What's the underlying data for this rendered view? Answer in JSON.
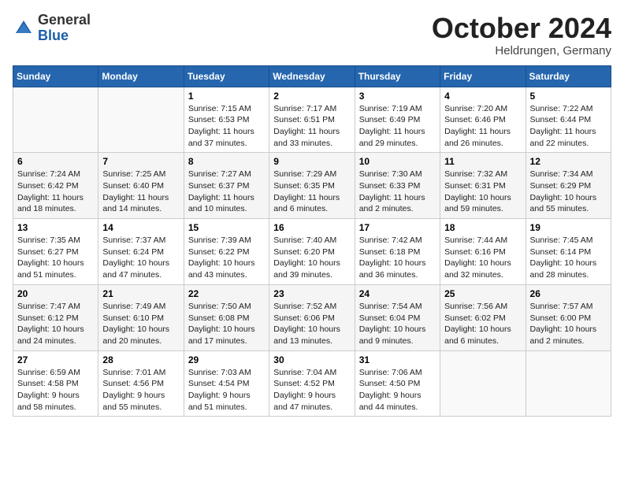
{
  "header": {
    "logo_general": "General",
    "logo_blue": "Blue",
    "month": "October 2024",
    "location": "Heldrungen, Germany"
  },
  "days_of_week": [
    "Sunday",
    "Monday",
    "Tuesday",
    "Wednesday",
    "Thursday",
    "Friday",
    "Saturday"
  ],
  "weeks": [
    [
      {
        "day": "",
        "sunrise": "",
        "sunset": "",
        "daylight": ""
      },
      {
        "day": "",
        "sunrise": "",
        "sunset": "",
        "daylight": ""
      },
      {
        "day": "1",
        "sunrise": "Sunrise: 7:15 AM",
        "sunset": "Sunset: 6:53 PM",
        "daylight": "Daylight: 11 hours and 37 minutes."
      },
      {
        "day": "2",
        "sunrise": "Sunrise: 7:17 AM",
        "sunset": "Sunset: 6:51 PM",
        "daylight": "Daylight: 11 hours and 33 minutes."
      },
      {
        "day": "3",
        "sunrise": "Sunrise: 7:19 AM",
        "sunset": "Sunset: 6:49 PM",
        "daylight": "Daylight: 11 hours and 29 minutes."
      },
      {
        "day": "4",
        "sunrise": "Sunrise: 7:20 AM",
        "sunset": "Sunset: 6:46 PM",
        "daylight": "Daylight: 11 hours and 26 minutes."
      },
      {
        "day": "5",
        "sunrise": "Sunrise: 7:22 AM",
        "sunset": "Sunset: 6:44 PM",
        "daylight": "Daylight: 11 hours and 22 minutes."
      }
    ],
    [
      {
        "day": "6",
        "sunrise": "Sunrise: 7:24 AM",
        "sunset": "Sunset: 6:42 PM",
        "daylight": "Daylight: 11 hours and 18 minutes."
      },
      {
        "day": "7",
        "sunrise": "Sunrise: 7:25 AM",
        "sunset": "Sunset: 6:40 PM",
        "daylight": "Daylight: 11 hours and 14 minutes."
      },
      {
        "day": "8",
        "sunrise": "Sunrise: 7:27 AM",
        "sunset": "Sunset: 6:37 PM",
        "daylight": "Daylight: 11 hours and 10 minutes."
      },
      {
        "day": "9",
        "sunrise": "Sunrise: 7:29 AM",
        "sunset": "Sunset: 6:35 PM",
        "daylight": "Daylight: 11 hours and 6 minutes."
      },
      {
        "day": "10",
        "sunrise": "Sunrise: 7:30 AM",
        "sunset": "Sunset: 6:33 PM",
        "daylight": "Daylight: 11 hours and 2 minutes."
      },
      {
        "day": "11",
        "sunrise": "Sunrise: 7:32 AM",
        "sunset": "Sunset: 6:31 PM",
        "daylight": "Daylight: 10 hours and 59 minutes."
      },
      {
        "day": "12",
        "sunrise": "Sunrise: 7:34 AM",
        "sunset": "Sunset: 6:29 PM",
        "daylight": "Daylight: 10 hours and 55 minutes."
      }
    ],
    [
      {
        "day": "13",
        "sunrise": "Sunrise: 7:35 AM",
        "sunset": "Sunset: 6:27 PM",
        "daylight": "Daylight: 10 hours and 51 minutes."
      },
      {
        "day": "14",
        "sunrise": "Sunrise: 7:37 AM",
        "sunset": "Sunset: 6:24 PM",
        "daylight": "Daylight: 10 hours and 47 minutes."
      },
      {
        "day": "15",
        "sunrise": "Sunrise: 7:39 AM",
        "sunset": "Sunset: 6:22 PM",
        "daylight": "Daylight: 10 hours and 43 minutes."
      },
      {
        "day": "16",
        "sunrise": "Sunrise: 7:40 AM",
        "sunset": "Sunset: 6:20 PM",
        "daylight": "Daylight: 10 hours and 39 minutes."
      },
      {
        "day": "17",
        "sunrise": "Sunrise: 7:42 AM",
        "sunset": "Sunset: 6:18 PM",
        "daylight": "Daylight: 10 hours and 36 minutes."
      },
      {
        "day": "18",
        "sunrise": "Sunrise: 7:44 AM",
        "sunset": "Sunset: 6:16 PM",
        "daylight": "Daylight: 10 hours and 32 minutes."
      },
      {
        "day": "19",
        "sunrise": "Sunrise: 7:45 AM",
        "sunset": "Sunset: 6:14 PM",
        "daylight": "Daylight: 10 hours and 28 minutes."
      }
    ],
    [
      {
        "day": "20",
        "sunrise": "Sunrise: 7:47 AM",
        "sunset": "Sunset: 6:12 PM",
        "daylight": "Daylight: 10 hours and 24 minutes."
      },
      {
        "day": "21",
        "sunrise": "Sunrise: 7:49 AM",
        "sunset": "Sunset: 6:10 PM",
        "daylight": "Daylight: 10 hours and 20 minutes."
      },
      {
        "day": "22",
        "sunrise": "Sunrise: 7:50 AM",
        "sunset": "Sunset: 6:08 PM",
        "daylight": "Daylight: 10 hours and 17 minutes."
      },
      {
        "day": "23",
        "sunrise": "Sunrise: 7:52 AM",
        "sunset": "Sunset: 6:06 PM",
        "daylight": "Daylight: 10 hours and 13 minutes."
      },
      {
        "day": "24",
        "sunrise": "Sunrise: 7:54 AM",
        "sunset": "Sunset: 6:04 PM",
        "daylight": "Daylight: 10 hours and 9 minutes."
      },
      {
        "day": "25",
        "sunrise": "Sunrise: 7:56 AM",
        "sunset": "Sunset: 6:02 PM",
        "daylight": "Daylight: 10 hours and 6 minutes."
      },
      {
        "day": "26",
        "sunrise": "Sunrise: 7:57 AM",
        "sunset": "Sunset: 6:00 PM",
        "daylight": "Daylight: 10 hours and 2 minutes."
      }
    ],
    [
      {
        "day": "27",
        "sunrise": "Sunrise: 6:59 AM",
        "sunset": "Sunset: 4:58 PM",
        "daylight": "Daylight: 9 hours and 58 minutes."
      },
      {
        "day": "28",
        "sunrise": "Sunrise: 7:01 AM",
        "sunset": "Sunset: 4:56 PM",
        "daylight": "Daylight: 9 hours and 55 minutes."
      },
      {
        "day": "29",
        "sunrise": "Sunrise: 7:03 AM",
        "sunset": "Sunset: 4:54 PM",
        "daylight": "Daylight: 9 hours and 51 minutes."
      },
      {
        "day": "30",
        "sunrise": "Sunrise: 7:04 AM",
        "sunset": "Sunset: 4:52 PM",
        "daylight": "Daylight: 9 hours and 47 minutes."
      },
      {
        "day": "31",
        "sunrise": "Sunrise: 7:06 AM",
        "sunset": "Sunset: 4:50 PM",
        "daylight": "Daylight: 9 hours and 44 minutes."
      },
      {
        "day": "",
        "sunrise": "",
        "sunset": "",
        "daylight": ""
      },
      {
        "day": "",
        "sunrise": "",
        "sunset": "",
        "daylight": ""
      }
    ]
  ]
}
